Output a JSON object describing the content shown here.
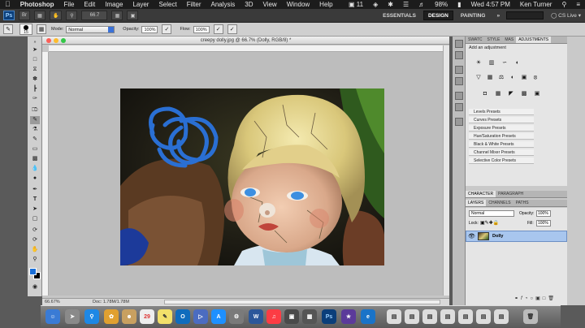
{
  "menubar": {
    "apple": "",
    "app_name": "Photoshop",
    "menus": [
      "File",
      "Edit",
      "Image",
      "Layer",
      "Select",
      "Filter",
      "Analysis",
      "3D",
      "View",
      "Window",
      "Help"
    ],
    "status": {
      "adobe_count": "11",
      "battery": "98%",
      "clock": "Wed 4:57 PM",
      "user": "Ken Turner"
    }
  },
  "appbar": {
    "logo": "Ps",
    "zoom": "66.7",
    "workspaces": [
      "ESSENTIALS",
      "DESIGN",
      "PAINTING"
    ],
    "active_workspace": "DESIGN",
    "cs_live": "CS Live"
  },
  "options": {
    "brush_size": "15",
    "mode_label": "Mode:",
    "mode_value": "Normal",
    "opacity_label": "Opacity:",
    "opacity_value": "100%",
    "flow_label": "Flow:",
    "flow_value": "100%"
  },
  "document": {
    "title": "creepy dolly.jpg @ 66.7% (Dolly, RGB/8) *",
    "zoom_status": "66.67%",
    "doc_status": "Doc: 1.78M/1.78M"
  },
  "adjustments": {
    "tabs": [
      "SWATC",
      "STYLE",
      "MAS",
      "ADJUSTMENTS"
    ],
    "header": "Add an adjustment",
    "presets": [
      "Levels Presets",
      "Curves Presets",
      "Exposure Presets",
      "Hue/Saturation Presets",
      "Black & White Presets",
      "Channel Mixer Presets",
      "Selective Color Presets"
    ]
  },
  "character": {
    "tabs": [
      "CHARACTER",
      "PARAGRAPH"
    ]
  },
  "layers": {
    "tabs": [
      "LAYERS",
      "CHANNELS",
      "PATHS"
    ],
    "blend_mode": "Normal",
    "opacity_label": "Opacity:",
    "opacity_value": "100%",
    "lock_label": "Lock:",
    "fill_label": "Fill:",
    "fill_value": "100%",
    "items": [
      {
        "name": "Dolly",
        "visible": true,
        "selected": true
      }
    ]
  },
  "colors": {
    "accent": "#3b72d8",
    "foreground": "#1a6fd8",
    "background": "#000000",
    "scribble": "#2a6fd3"
  }
}
